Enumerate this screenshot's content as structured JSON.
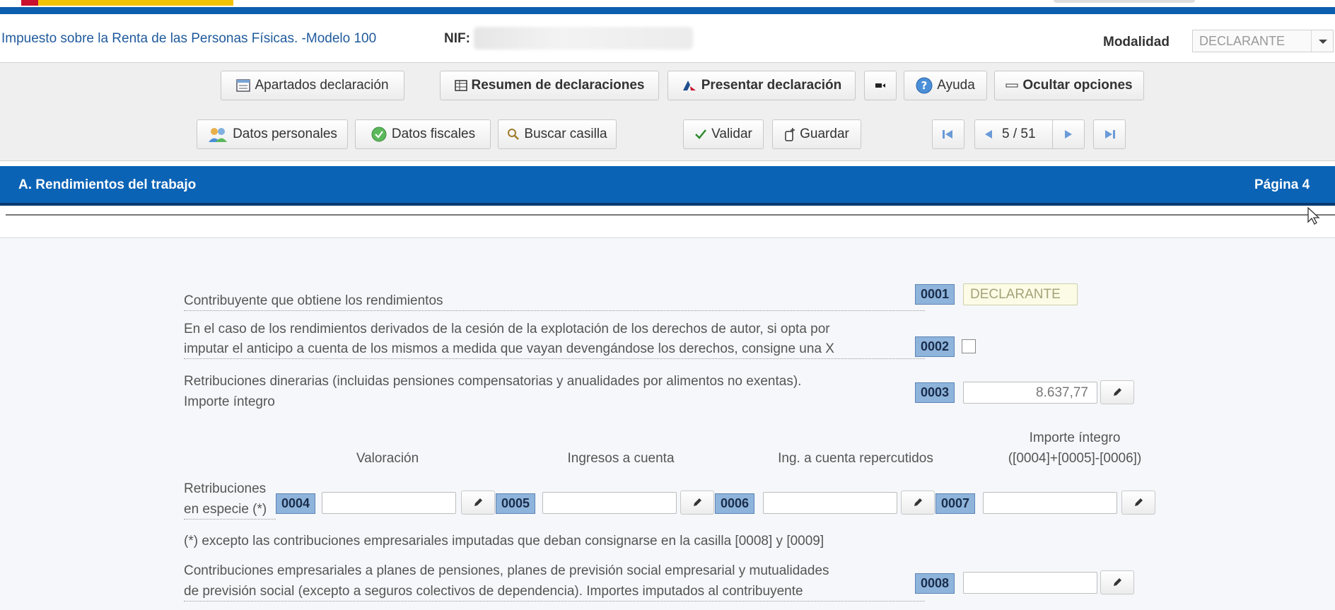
{
  "header": {
    "app_title": "Impuesto sobre la Renta de las Personas Físicas. -Modelo 100",
    "nif_label": "NIF:",
    "modalidad_label": "Modalidad",
    "modalidad_value": "DECLARANTE"
  },
  "toolbar": {
    "row1": {
      "apartados": "Apartados declaración",
      "resumen": "Resumen de declaraciones",
      "presentar": "Presentar declaración",
      "ayuda": "Ayuda",
      "ocultar": "Ocultar opciones"
    },
    "row2": {
      "datos_personales": "Datos personales",
      "datos_fiscales": "Datos fiscales",
      "buscar": "Buscar casilla",
      "validar": "Validar",
      "guardar": "Guardar",
      "pagination": "5 / 51"
    }
  },
  "section": {
    "title": "A.  Rendimientos del trabajo",
    "page": "Página 4"
  },
  "form": {
    "row_0001": {
      "label": "Contribuyente que obtiene los rendimientos",
      "code": "0001",
      "value": "DECLARANTE"
    },
    "row_0002": {
      "label_line1": "En el caso de los rendimientos derivados de la cesión de la explotación de los derechos de autor, si opta por",
      "label_line2": "imputar el anticipo a cuenta de los mismos a medida que vayan devengándose los derechos, consigne una X",
      "code": "0002"
    },
    "row_0003": {
      "label_line1": "Retribuciones dinerarias (incluidas pensiones compensatorias y anualidades por alimentos no exentas).",
      "label_line2": "Importe íntegro",
      "code": "0003",
      "value": "8.637,77"
    },
    "columns": {
      "valoracion": "Valoración",
      "ingresos": "Ingresos a cuenta",
      "repercutidos": "Ing. a cuenta repercutidos",
      "importe_line1": "Importe íntegro",
      "importe_line2": "([0004]+[0005]-[0006])"
    },
    "row_especie": {
      "label_line1": "Retribuciones",
      "label_line2": "en especie (*)",
      "code_0004": "0004",
      "code_0005": "0005",
      "code_0006": "0006",
      "code_0007": "0007"
    },
    "note": "(*) excepto las contribuciones empresariales imputadas que deban consignarse en la casilla [0008] y [0009]",
    "row_0008": {
      "label_line1": "Contribuciones empresariales a planes de pensiones, planes de previsión social empresarial y mutualidades",
      "label_line2": "de previsión social (excepto a seguros colectivos de dependencia). Importes imputados al contribuyente",
      "code": "0008"
    }
  },
  "colors": {
    "section_blue": "#0a63b5",
    "code_bg": "#8fb4dc",
    "title_blue": "#1f5a9c"
  }
}
